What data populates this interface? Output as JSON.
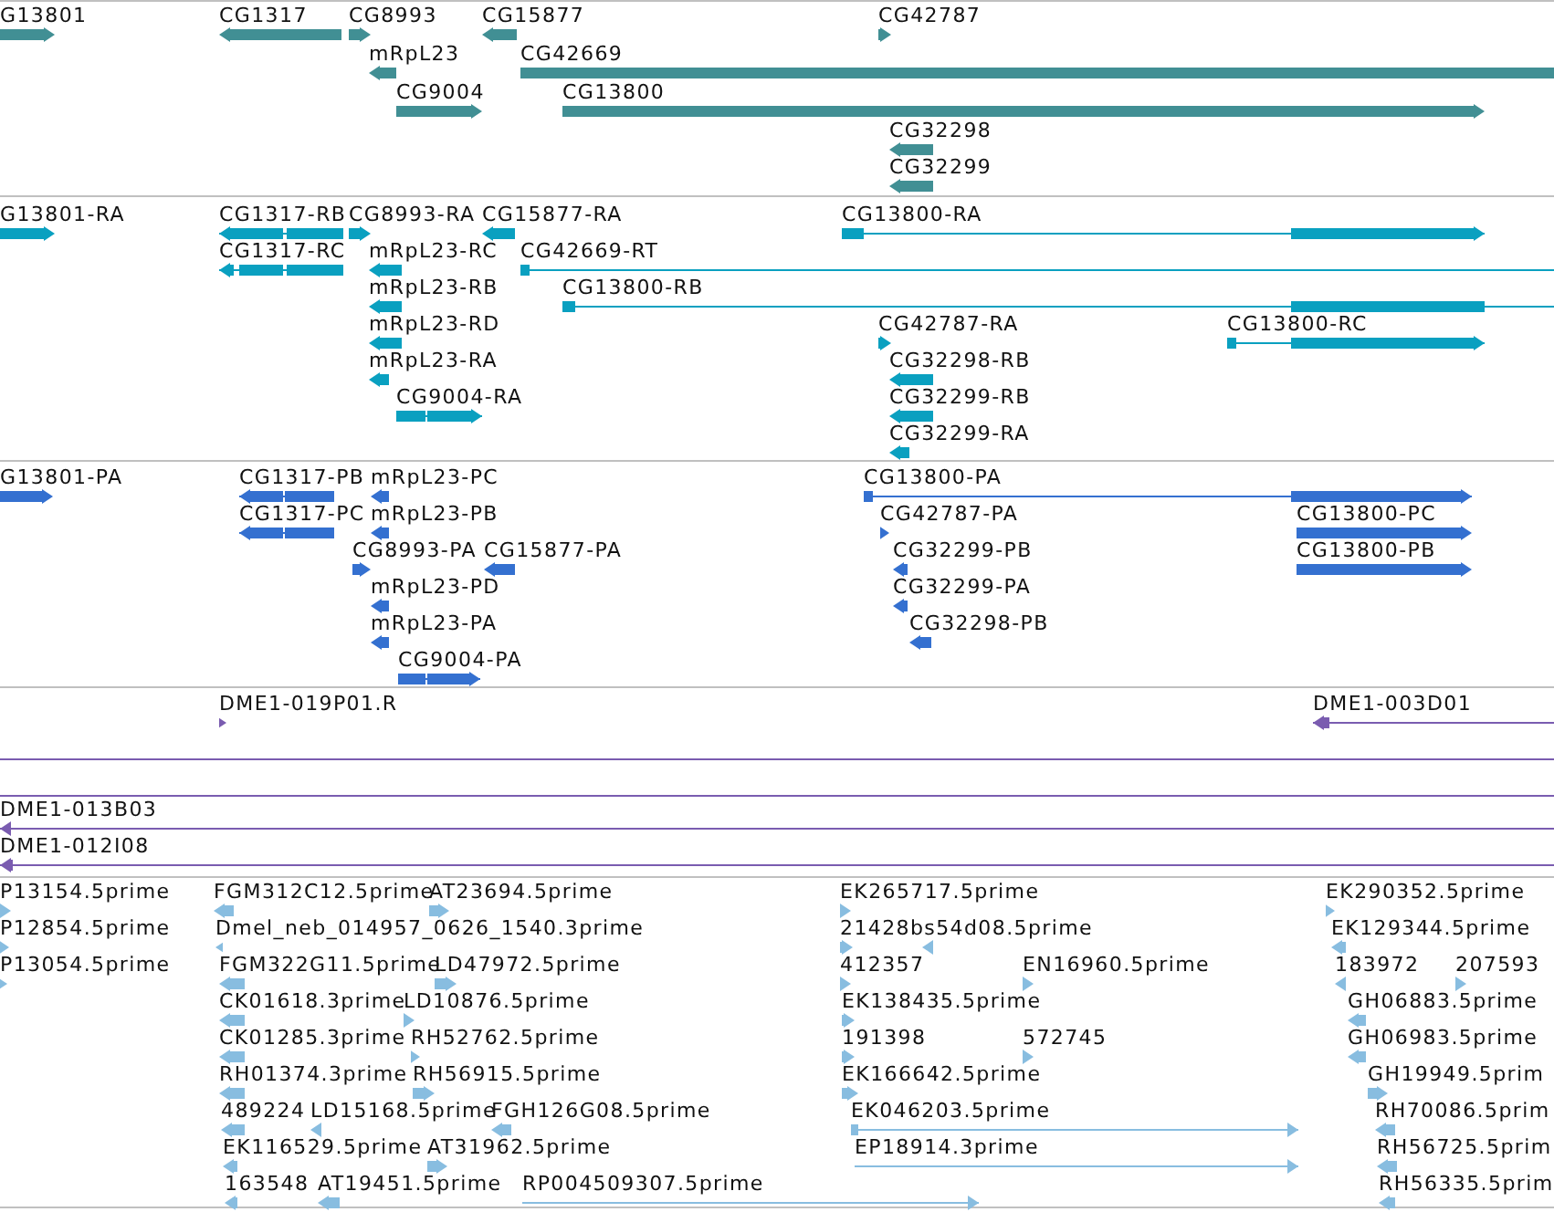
{
  "tracks": [
    {
      "color": "#418f94",
      "features": [
        {
          "label": "G13801",
          "kind": "forward"
        },
        {
          "label": "CG1317",
          "kind": "reverse"
        },
        {
          "label": "CG8993",
          "kind": "forward"
        },
        {
          "label": "CG15877",
          "kind": "reverse"
        },
        {
          "label": "CG42787",
          "kind": "forward"
        },
        {
          "label": "mRpL23",
          "kind": "reverse"
        },
        {
          "label": "CG42669",
          "kind": "plain"
        },
        {
          "label": "CG9004",
          "kind": "forward"
        },
        {
          "label": "CG13800",
          "kind": "forward"
        },
        {
          "label": "CG32298",
          "kind": "reverse"
        },
        {
          "label": "CG32299",
          "kind": "reverse"
        }
      ]
    },
    {
      "color": "#0aa0c0",
      "features": [
        {
          "label": "G13801-RA",
          "kind": "forward"
        },
        {
          "label": "CG1317-RB",
          "kind": "reverse"
        },
        {
          "label": "CG8993-RA",
          "kind": "forward"
        },
        {
          "label": "CG15877-RA",
          "kind": "reverse"
        },
        {
          "label": "CG13800-RA",
          "kind": "forward"
        },
        {
          "label": "CG1317-RC",
          "kind": "reverse"
        },
        {
          "label": "mRpL23-RC",
          "kind": "reverse"
        },
        {
          "label": "CG42669-RT",
          "kind": "plain"
        },
        {
          "label": "mRpL23-RB",
          "kind": "reverse"
        },
        {
          "label": "CG13800-RB",
          "kind": "plain"
        },
        {
          "label": "mRpL23-RD",
          "kind": "reverse"
        },
        {
          "label": "CG42787-RA",
          "kind": "forward"
        },
        {
          "label": "CG13800-RC",
          "kind": "forward"
        },
        {
          "label": "mRpL23-RA",
          "kind": "reverse"
        },
        {
          "label": "CG32298-RB",
          "kind": "reverse"
        },
        {
          "label": "CG9004-RA",
          "kind": "forward"
        },
        {
          "label": "CG32299-RB",
          "kind": "reverse"
        },
        {
          "label": "CG32299-RA",
          "kind": "reverse"
        }
      ]
    },
    {
      "color": "#3470d0",
      "features": [
        {
          "label": "G13801-PA",
          "kind": "forward"
        },
        {
          "label": "CG1317-PB",
          "kind": "reverse"
        },
        {
          "label": "mRpL23-PC",
          "kind": "reverse"
        },
        {
          "label": "CG13800-PA",
          "kind": "forward"
        },
        {
          "label": "CG1317-PC",
          "kind": "reverse"
        },
        {
          "label": "mRpL23-PB",
          "kind": "reverse"
        },
        {
          "label": "CG42787-PA",
          "kind": "forward"
        },
        {
          "label": "CG13800-PC",
          "kind": "forward"
        },
        {
          "label": "CG8993-PA",
          "kind": "forward"
        },
        {
          "label": "CG15877-PA",
          "kind": "reverse"
        },
        {
          "label": "CG32299-PB",
          "kind": "reverse"
        },
        {
          "label": "CG13800-PB",
          "kind": "forward"
        },
        {
          "label": "mRpL23-PD",
          "kind": "reverse"
        },
        {
          "label": "CG32299-PA",
          "kind": "reverse"
        },
        {
          "label": "mRpL23-PA",
          "kind": "reverse"
        },
        {
          "label": "CG32298-PB",
          "kind": "reverse"
        },
        {
          "label": "CG9004-PA",
          "kind": "forward"
        }
      ]
    },
    {
      "color": "#7a5cb0",
      "features": [
        {
          "label": "DME1-019P01.R",
          "kind": "forward"
        },
        {
          "label": "DME1-003D01",
          "kind": "reverse"
        },
        {
          "kind": "plain"
        },
        {
          "kind": "plain"
        },
        {
          "label": "DME1-013B03",
          "kind": "reverse"
        },
        {
          "label": "DME1-012I08",
          "kind": "reverse"
        }
      ]
    },
    {
      "color": "#88bde0",
      "features": [
        {
          "label": "P13154.5prime",
          "kind": "forward"
        },
        {
          "label": "FGM312C12.5prime",
          "kind": "reverse"
        },
        {
          "label": "AT23694.5prime",
          "kind": "forward"
        },
        {
          "label": "EK265717.5prime",
          "kind": "forward"
        },
        {
          "label": "EK290352.5prime",
          "kind": "forward"
        },
        {
          "label": "P12854.5prime",
          "kind": "forward"
        },
        {
          "label": "Dmel_neb_014957_0626_1540.3prime",
          "kind": "reverse"
        },
        {
          "label": "21428bs54d08.5prime",
          "kind": "forward"
        },
        {
          "kind": "reverse"
        },
        {
          "label": "EK129344.5prime",
          "kind": "reverse"
        },
        {
          "label": "P13054.5prime",
          "kind": "forward"
        },
        {
          "label": "FGM322G11.5prime",
          "kind": "reverse"
        },
        {
          "label": "LD47972.5prime",
          "kind": "forward"
        },
        {
          "label": "412357",
          "kind": "forward"
        },
        {
          "label": "EN16960.5prime",
          "kind": "forward"
        },
        {
          "label": "183972",
          "kind": "reverse"
        },
        {
          "label": "207593",
          "kind": "forward"
        },
        {
          "label": "CK01618.3prime",
          "kind": "reverse"
        },
        {
          "label": "LD10876.5prime",
          "kind": "forward"
        },
        {
          "label": "EK138435.5prime",
          "kind": "forward"
        },
        {
          "label": "GH06883.5prime",
          "kind": "reverse"
        },
        {
          "label": "CK01285.3prime",
          "kind": "reverse"
        },
        {
          "label": "RH52762.5prime",
          "kind": "forward"
        },
        {
          "label": "191398",
          "kind": "forward"
        },
        {
          "label": "572745",
          "kind": "forward"
        },
        {
          "label": "GH06983.5prime",
          "kind": "reverse"
        },
        {
          "label": "RH01374.3prime",
          "kind": "reverse"
        },
        {
          "label": "RH56915.5prime",
          "kind": "forward"
        },
        {
          "label": "EK166642.5prime",
          "kind": "forward"
        },
        {
          "label": "GH19949.5prim",
          "kind": "forward"
        },
        {
          "label": "489224",
          "kind": "reverse"
        },
        {
          "label": "LD15168.5prime",
          "kind": "reverse"
        },
        {
          "label": "FGH126G08.5prime",
          "kind": "reverse"
        },
        {
          "label": "EK046203.5prime",
          "kind": "forward"
        },
        {
          "label": "RH70086.5prim",
          "kind": "reverse"
        },
        {
          "label": "EK116529.5prime",
          "kind": "reverse"
        },
        {
          "label": "AT31962.5prime",
          "kind": "forward"
        },
        {
          "label": "EP18914.3prime",
          "kind": "forward"
        },
        {
          "label": "RH56725.5prim",
          "kind": "reverse"
        },
        {
          "label": "163548",
          "kind": "reverse"
        },
        {
          "label": "AT19451.5prime",
          "kind": "reverse"
        },
        {
          "label": "RP004509307.5prime",
          "kind": "forward"
        },
        {
          "label": "RH56335.5prim",
          "kind": "reverse"
        }
      ]
    }
  ]
}
